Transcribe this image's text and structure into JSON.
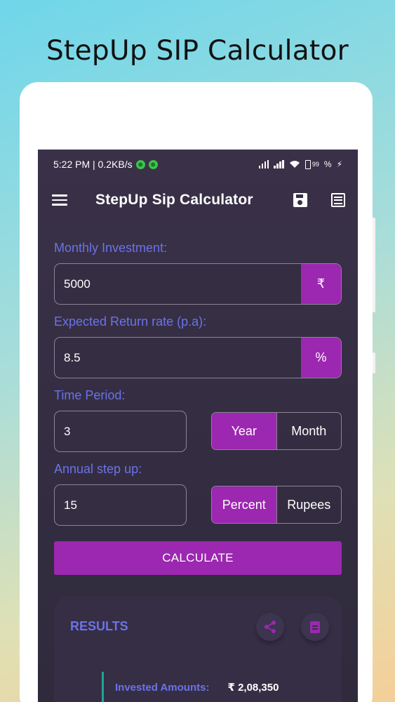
{
  "headline": "StepUp SIP Calculator",
  "status_bar": {
    "time_speed": "5:22 PM | 0.2KB/s",
    "battery": "99",
    "percent_sign": "%"
  },
  "app_bar": {
    "title": "StepUp Sip Calculator"
  },
  "form": {
    "monthly_investment": {
      "label": "Monthly Investment:",
      "value": "5000",
      "unit": "₹"
    },
    "return_rate": {
      "label": "Expected Return rate (p.a):",
      "value": "8.5",
      "unit": "%"
    },
    "time_period": {
      "label": "Time Period:",
      "value": "3",
      "options": [
        "Year",
        "Month"
      ],
      "selected": "Year"
    },
    "step_up": {
      "label": "Annual step up:",
      "value": "15",
      "options": [
        "Percent",
        "Rupees"
      ],
      "selected": "Percent"
    }
  },
  "calculate_label": "CALCULATE",
  "results": {
    "title": "RESULTS",
    "invested_label": "Invested Amounts:",
    "invested_value": "₹ 2,08,350"
  },
  "colors": {
    "accent": "#9c27b0",
    "label": "#6a73e8",
    "teal": "#1aa39a"
  }
}
